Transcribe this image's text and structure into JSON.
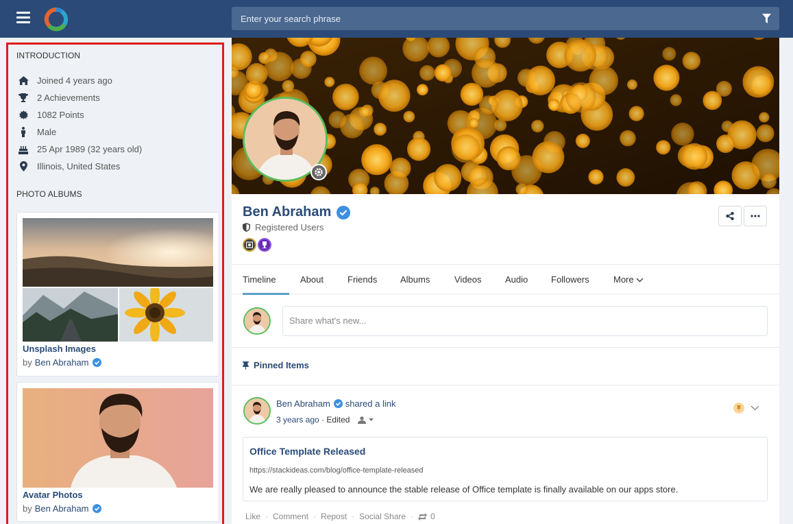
{
  "header": {
    "search_placeholder": "Enter your search phrase"
  },
  "sidebar": {
    "intro_title": "INTRODUCTION",
    "intro_items": [
      {
        "icon": "home-icon",
        "text": "Joined 4 years ago"
      },
      {
        "icon": "trophy-icon",
        "text": "2 Achievements"
      },
      {
        "icon": "badge-icon",
        "text": "1082 Points"
      },
      {
        "icon": "male-icon",
        "text": "Male"
      },
      {
        "icon": "birthday-cake-icon",
        "text": "25 Apr 1989 (32 years old)"
      },
      {
        "icon": "location-pin-icon",
        "text": "Illinois, United States"
      }
    ],
    "albums_title": "PHOTO ALBUMS",
    "albums": [
      {
        "name": "Unsplash Images",
        "by": "by",
        "author": "Ben Abraham"
      },
      {
        "name": "Avatar Photos",
        "by": "by",
        "author": "Ben Abraham"
      }
    ]
  },
  "profile": {
    "name": "Ben Abraham",
    "role": "Registered Users"
  },
  "tabs": [
    "Timeline",
    "About",
    "Friends",
    "Albums",
    "Videos",
    "Audio",
    "Followers",
    "More"
  ],
  "composer": {
    "placeholder": "Share what's new..."
  },
  "pinned": {
    "label": "Pinned Items"
  },
  "post": {
    "author": "Ben Abraham",
    "action": "shared a link",
    "time": "3 years ago",
    "sep": " · ",
    "edited": "Edited",
    "link_title": "Office Template Released",
    "link_url": "https://stackideas.com/blog/office-template-released",
    "link_desc": "We are really pleased to announce the stable release of Office template is finally available on our apps store.",
    "actions": {
      "like": "Like",
      "comment": "Comment",
      "repost": "Repost",
      "social_share": "Social Share",
      "sep": "·",
      "repost_count": "0"
    }
  },
  "colors": {
    "topbar": "#2b4a77",
    "accent": "#2b4a77",
    "verified": "#3d8fe0",
    "highlight_border": "#e01b1b",
    "avatar_ring": "#5bbd5b"
  }
}
